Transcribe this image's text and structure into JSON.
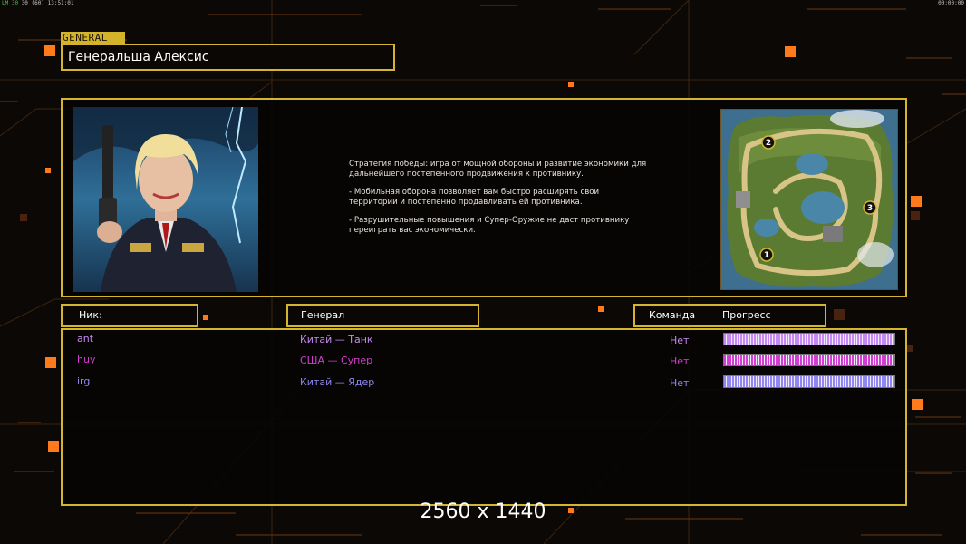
{
  "hud": {
    "left_fps": "LM 30",
    "left_extra": "30 (60)",
    "left_time": "13:51:01",
    "right_time": "00:00:00"
  },
  "header": {
    "tag": "GENERAL",
    "general_name": "Генеральша Алексис"
  },
  "info": {
    "description": [
      "Стратегия победы: игра от мощной обороны и развитие экономики для дальнейшего постепенного продвижения к противнику.",
      "- Мобильная оборона позволяет вам быстро расширять свои территории и постепенно продавливать ей противника.",
      "- Разрушительные повышения и Супер-Оружие не даст противнику переиграть вас экономически."
    ],
    "map_positions": [
      "1",
      "2",
      "3"
    ]
  },
  "columns": {
    "nick": "Ник:",
    "general": "Генерал",
    "team": "Команда",
    "progress": "Прогресс"
  },
  "players": [
    {
      "nick": "ant",
      "general": "Китай — Танк",
      "team": "Нет",
      "color": "#c48af2",
      "progress": 1.0
    },
    {
      "nick": "huy",
      "general": "США — Супер",
      "team": "Нет",
      "color": "#d23ed2",
      "progress": 1.0
    },
    {
      "nick": "irg",
      "general": "Китай — Ядер",
      "team": "Нет",
      "color": "#8e88f0",
      "progress": 1.0
    }
  ],
  "footer": {
    "resolution": "2560 x 1440"
  },
  "colors": {
    "frame": "#d4b62e",
    "accent_orange": "#ff7a1a",
    "background": "#0c0806"
  }
}
